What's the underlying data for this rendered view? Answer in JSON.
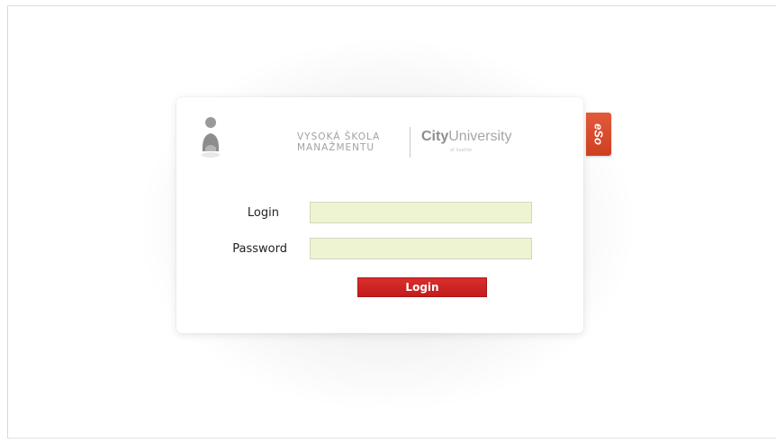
{
  "brand": {
    "school_line1": "VYSOKÁ ŠKOLA",
    "school_line2": "MANAŽMENTU",
    "city_bold": "City",
    "city_light": "University",
    "city_sub": "of Seattle",
    "eso_tab": "eSo",
    "accent_color": "#d9442a"
  },
  "form": {
    "login_label": "Login",
    "login_value": "",
    "password_label": "Password",
    "password_value": "",
    "submit_label": "Login",
    "field_bg_color": "#eef3d2",
    "button_color": "#cc2424"
  },
  "icons": {
    "avatar": "user-avatar-icon"
  }
}
